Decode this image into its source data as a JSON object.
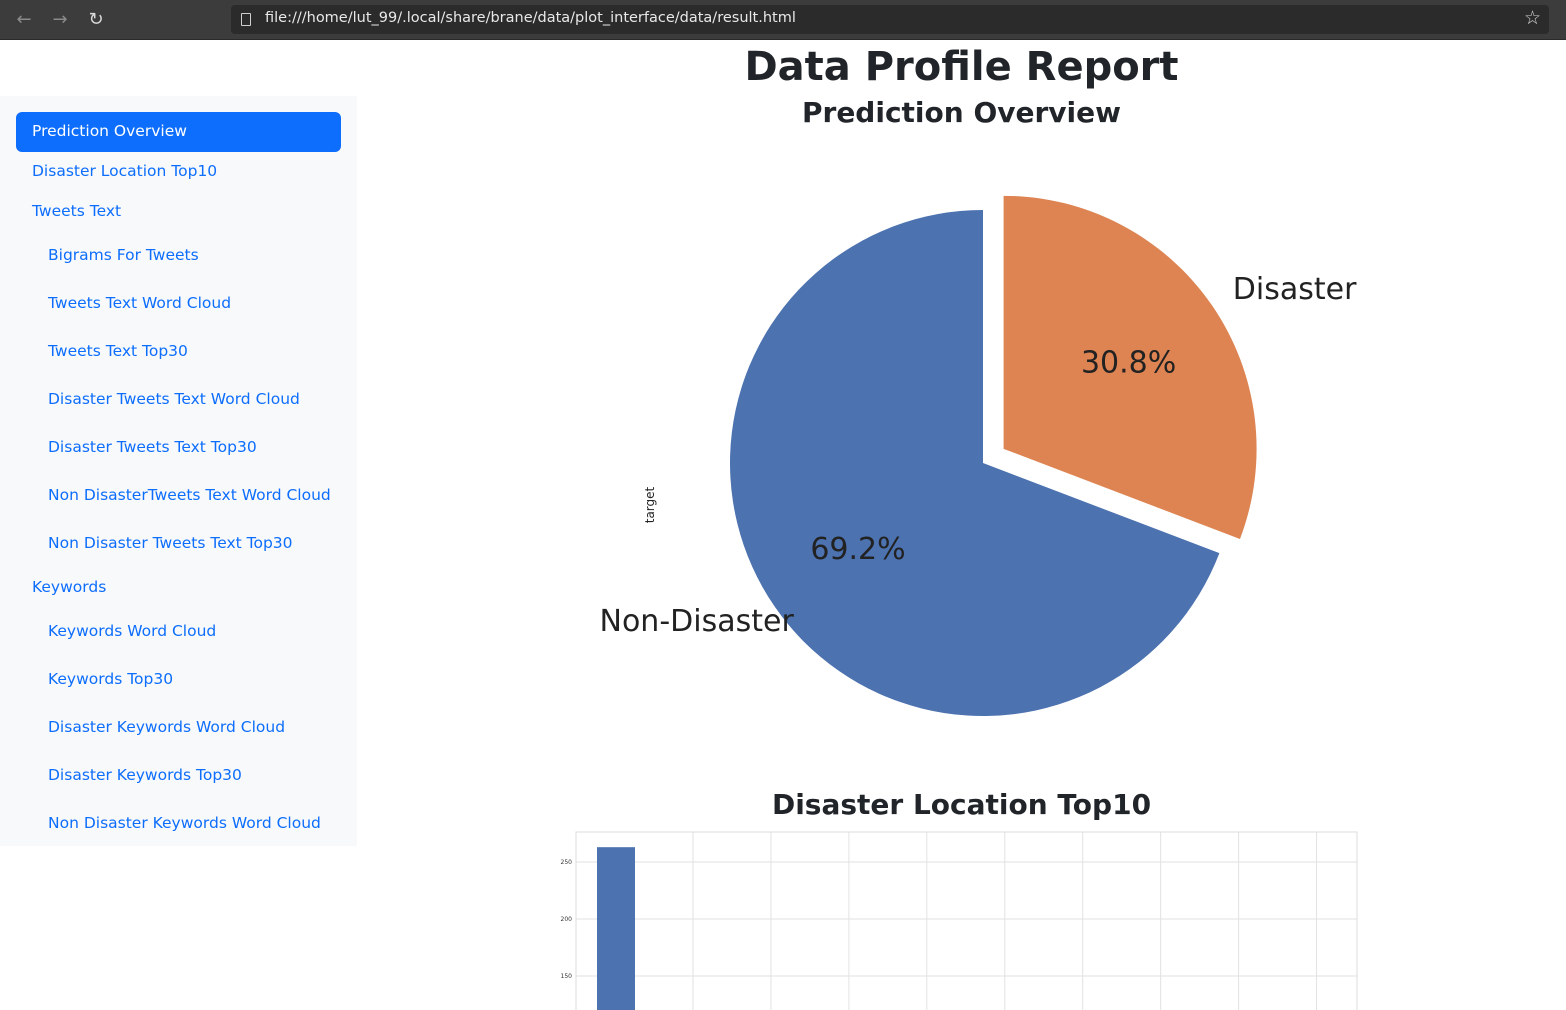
{
  "browser": {
    "url": "file:///home/lut_99/.local/share/brane/data/plot_interface/data/result.html"
  },
  "sidebar": {
    "items": [
      {
        "label": "Prediction Overview",
        "level": 1,
        "active": true
      },
      {
        "label": "Disaster Location Top10",
        "level": 1
      },
      {
        "label": "Tweets Text",
        "level": 1
      },
      {
        "label": "Bigrams For Tweets",
        "level": 2
      },
      {
        "label": "Tweets Text Word Cloud",
        "level": 2
      },
      {
        "label": "Tweets Text Top30",
        "level": 2
      },
      {
        "label": "Disaster Tweets Text Word Cloud",
        "level": 2
      },
      {
        "label": "Disaster Tweets Text Top30",
        "level": 2
      },
      {
        "label": "Non DisasterTweets Text Word Cloud",
        "level": 2
      },
      {
        "label": "Non Disaster Tweets Text Top30",
        "level": 2
      },
      {
        "label": "Keywords",
        "level": 1
      },
      {
        "label": "Keywords Word Cloud",
        "level": 2
      },
      {
        "label": "Keywords Top30",
        "level": 2
      },
      {
        "label": "Disaster Keywords Word Cloud",
        "level": 2
      },
      {
        "label": "Disaster Keywords Top30",
        "level": 2
      },
      {
        "label": "Non Disaster Keywords Word Cloud",
        "level": 2
      }
    ]
  },
  "main": {
    "title": "Data Profile Report",
    "sections": [
      {
        "title": "Prediction Overview"
      },
      {
        "title": "Disaster Location Top10"
      }
    ]
  },
  "chart_data": [
    {
      "type": "pie",
      "title": "",
      "ylabel": "target",
      "labels": [
        "Disaster",
        "Non-Disaster"
      ],
      "values": [
        30.8,
        69.2
      ],
      "value_labels": [
        "30.8%",
        "69.2%"
      ],
      "colors": [
        "#dd8452",
        "#4c72b0"
      ],
      "exploded": [
        "Disaster"
      ]
    },
    {
      "type": "bar",
      "title": "",
      "yticks": [
        "250",
        "200",
        "150"
      ],
      "ylim": [
        0,
        285
      ],
      "values": [
        263
      ],
      "color": "#4c72b0",
      "grid": true
    }
  ]
}
